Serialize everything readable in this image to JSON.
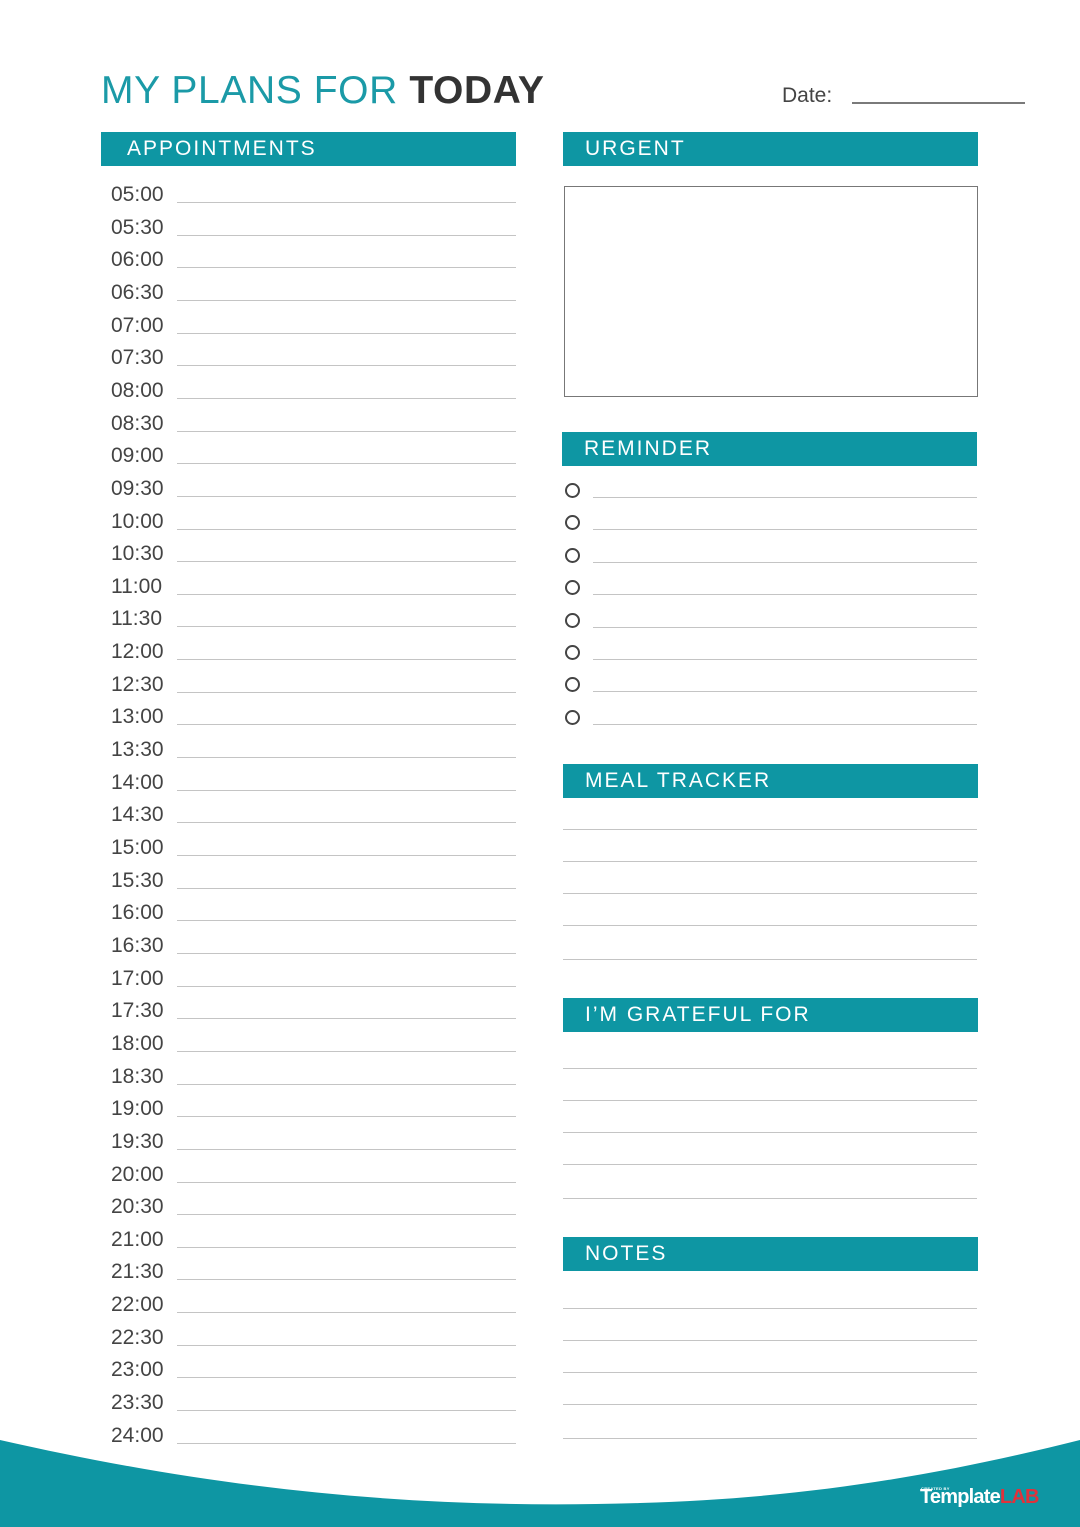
{
  "header": {
    "title_light": "MY PLANS FOR ",
    "title_bold": "TODAY",
    "date_label": "Date:",
    "date_value": ""
  },
  "appointments": {
    "label": "APPOINTMENTS",
    "times": [
      "05:00",
      "05:30",
      "06:00",
      "06:30",
      "07:00",
      "07:30",
      "08:00",
      "08:30",
      "09:00",
      "09:30",
      "10:00",
      "10:30",
      "11:00",
      "11:30",
      "12:00",
      "12:30",
      "13:00",
      "13:30",
      "14:00",
      "14:30",
      "15:00",
      "15:30",
      "16:00",
      "16:30",
      "17:00",
      "17:30",
      "18:00",
      "18:30",
      "19:00",
      "19:30",
      "20:00",
      "20:30",
      "21:00",
      "21:30",
      "22:00",
      "22:30",
      "23:00",
      "23:30",
      "24:00"
    ]
  },
  "urgent": {
    "label": "URGENT",
    "content": ""
  },
  "reminder": {
    "label": "REMINDER",
    "items": [
      "",
      "",
      "",
      "",
      "",
      "",
      "",
      ""
    ]
  },
  "meal_tracker": {
    "label": "MEAL TRACKER",
    "lines": [
      "",
      "",
      "",
      "",
      ""
    ]
  },
  "grateful": {
    "label": "I’M GRATEFUL FOR",
    "lines": [
      "",
      "",
      "",
      "",
      ""
    ]
  },
  "notes": {
    "label": "NOTES",
    "lines": [
      "",
      "",
      "",
      "",
      ""
    ]
  },
  "branding": {
    "created_by": "CREATED BY",
    "name_part1": "Template",
    "name_part2": "LAB"
  },
  "colors": {
    "accent": "#0e96a3",
    "title": "#1b9aa7",
    "title_bold": "#333333",
    "brand_red": "#e0323b"
  }
}
